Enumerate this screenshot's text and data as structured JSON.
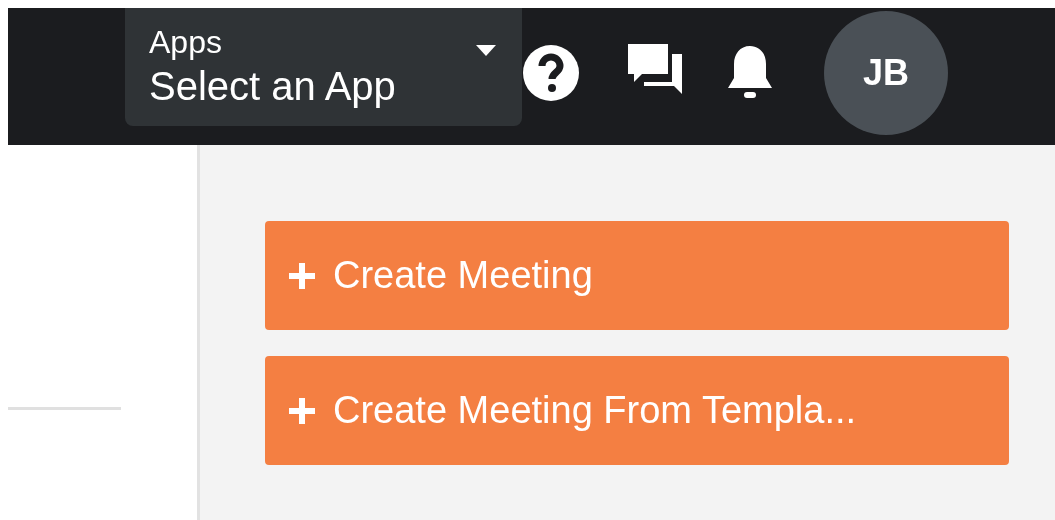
{
  "top_bar": {
    "app_selector": {
      "label": "Apps",
      "value": "Select an App"
    },
    "avatar": {
      "initials": "JB"
    }
  },
  "actions": [
    {
      "label": "Create Meeting"
    },
    {
      "label": "Create Meeting From Templa..."
    }
  ]
}
